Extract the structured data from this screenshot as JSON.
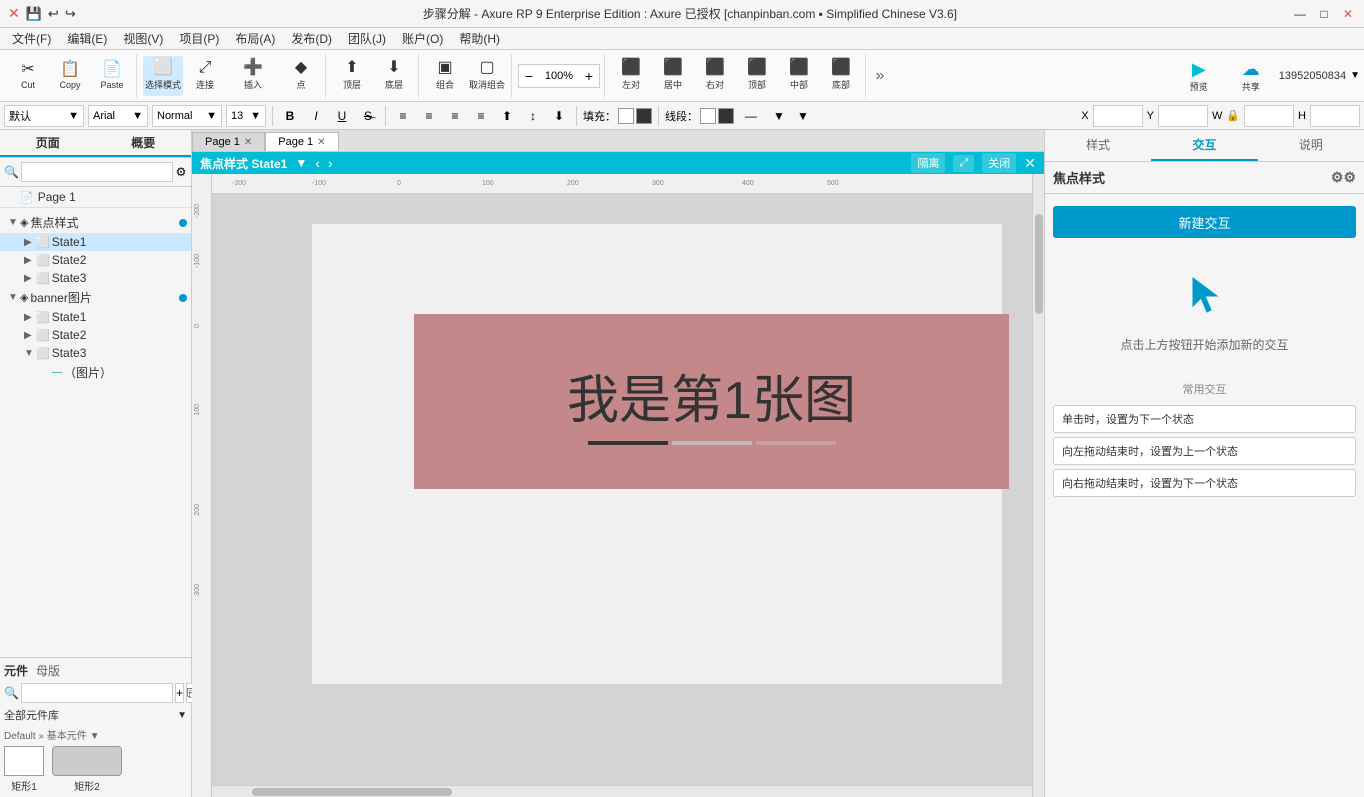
{
  "titleBar": {
    "title": "步骤分解 - Axure RP 9 Enterprise Edition : Axure 已授权    [chanpinban.com ▪ Simplified Chinese V3.6]",
    "closeBtn": "✕",
    "maxBtn": "□",
    "minBtn": "—",
    "xIcon": "✕",
    "saveIcon": "💾",
    "undoIcon": "↩",
    "redoIcon": "↪"
  },
  "menuBar": {
    "items": [
      "文件(F)",
      "编辑(E)",
      "视图(V)",
      "项目(P)",
      "布局(A)",
      "发布(D)",
      "团队(J)",
      "账户(O)",
      "帮助(H)"
    ]
  },
  "toolbar": {
    "cut": "Cut",
    "copy": "Copy",
    "paste": "Paste",
    "selectMode": "选择模式",
    "connect": "连接",
    "insert": "插入",
    "point": "点",
    "top": "顶层",
    "bottom": "底层",
    "group": "组合",
    "ungroup": "取消组合",
    "left": "左对",
    "center": "居中",
    "right": "右对",
    "topAlign": "顶部",
    "middle": "中部",
    "bottomAlign": "底部",
    "moreBtn": "»",
    "previewIcon": "▶",
    "previewLabel": "预览",
    "shareIcon": "☁",
    "shareLabel": "共享",
    "phoneNumber": "13952050834",
    "zoomValue": "100%"
  },
  "formatBar": {
    "defaultLabel": "默认",
    "fontFamily": "Arial",
    "textStyle": "Normal",
    "fontSize": "13",
    "boldBtn": "B",
    "italicBtn": "I",
    "underlineBtn": "U",
    "strikeBtn": "S̶",
    "fillLabel": "填充：",
    "lineLabel": "线段：",
    "xLabel": "X",
    "yLabel": "Y",
    "wLabel": "W",
    "hLabel": "H",
    "lockIcon": "🔒"
  },
  "leftPanel": {
    "tab1": "概要",
    "tab2": "概要",
    "pageItem": "Page 1",
    "treeItems": [
      {
        "label": "焦点样式",
        "level": 0,
        "expanded": true,
        "type": "group",
        "hasDot": true
      },
      {
        "label": "State1",
        "level": 1,
        "expanded": false,
        "type": "state",
        "selected": true
      },
      {
        "label": "State2",
        "level": 1,
        "expanded": false,
        "type": "state"
      },
      {
        "label": "State3",
        "level": 1,
        "expanded": false,
        "type": "state"
      },
      {
        "label": "banner图片",
        "level": 0,
        "expanded": true,
        "type": "group",
        "hasDot": true
      },
      {
        "label": "State1",
        "level": 1,
        "expanded": false,
        "type": "state"
      },
      {
        "label": "State2",
        "level": 1,
        "expanded": false,
        "type": "state"
      },
      {
        "label": "State3",
        "level": 1,
        "expanded": false,
        "type": "state"
      },
      {
        "label": "（图片）",
        "level": 2,
        "expanded": false,
        "type": "image",
        "hasDotGreen": true
      }
    ]
  },
  "componentPanel": {
    "tab1": "元件",
    "tab2": "母版",
    "libraryTitle": "全部元件库",
    "subTitle": "Default » 基本元件 ▼",
    "items": [
      {
        "label": "矩形1"
      },
      {
        "label": "矩形2"
      }
    ]
  },
  "canvas": {
    "tabs": [
      {
        "label": "Page 1",
        "active": false
      },
      {
        "label": "Page 1",
        "active": true
      }
    ],
    "headerTitle": "焦点样式  State1 ▼",
    "hideBtn": "隔离",
    "expandBtn": "⤢",
    "closeBtn": "关闭",
    "rulerMarks": [
      "-200",
      "-100",
      "0",
      "100",
      "200",
      "300",
      "400",
      "500"
    ],
    "bannerText": "我是第1张图",
    "bannerBg": "#c4888a"
  },
  "rightPanel": {
    "tab1": "样式",
    "tab2": "交互",
    "tab3": "说明",
    "sectionTitle": "焦点样式",
    "newInteractionBtn": "新建交互",
    "hintText": "点击上方按钮开始添加新的交互",
    "commonHeader": "常用交互",
    "interactions": [
      "单击时，设置为下一个状态",
      "向左拖动结束时，设置为上一个状态",
      "向右拖动结束时，设置为下一个状态"
    ]
  }
}
